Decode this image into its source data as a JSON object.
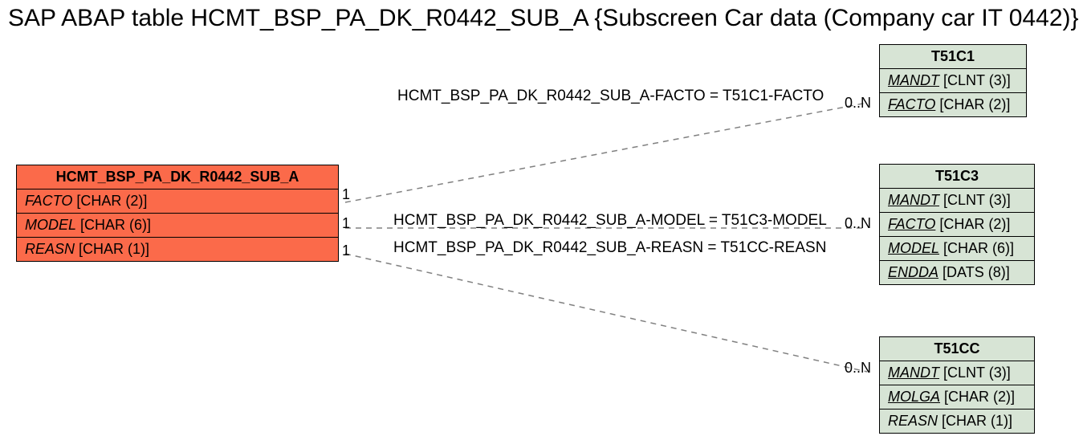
{
  "title": "SAP ABAP table HCMT_BSP_PA_DK_R0442_SUB_A {Subscreen Car data (Company car IT 0442)}",
  "main": {
    "name": "HCMT_BSP_PA_DK_R0442_SUB_A",
    "fields": [
      {
        "name": "FACTO",
        "type": "[CHAR (2)]"
      },
      {
        "name": "MODEL",
        "type": "[CHAR (6)]"
      },
      {
        "name": "REASN",
        "type": "[CHAR (1)]"
      }
    ]
  },
  "t51c1": {
    "name": "T51C1",
    "fields": [
      {
        "name": "MANDT",
        "type": "[CLNT (3)]",
        "pk": true
      },
      {
        "name": "FACTO",
        "type": "[CHAR (2)]",
        "pk": true
      }
    ]
  },
  "t51c3": {
    "name": "T51C3",
    "fields": [
      {
        "name": "MANDT",
        "type": "[CLNT (3)]",
        "pk": true
      },
      {
        "name": "FACTO",
        "type": "[CHAR (2)]",
        "pk": true
      },
      {
        "name": "MODEL",
        "type": "[CHAR (6)]",
        "pk": true
      },
      {
        "name": "ENDDA",
        "type": "[DATS (8)]",
        "pk": true
      }
    ]
  },
  "t51cc": {
    "name": "T51CC",
    "fields": [
      {
        "name": "MANDT",
        "type": "[CLNT (3)]",
        "pk": true
      },
      {
        "name": "MOLGA",
        "type": "[CHAR (2)]",
        "pk": true
      },
      {
        "name": "REASN",
        "type": "[CHAR (1)]",
        "pk": false
      }
    ]
  },
  "rels": {
    "r1": "HCMT_BSP_PA_DK_R0442_SUB_A-FACTO = T51C1-FACTO",
    "r2": "HCMT_BSP_PA_DK_R0442_SUB_A-MODEL = T51C3-MODEL",
    "r3": "HCMT_BSP_PA_DK_R0442_SUB_A-REASN = T51CC-REASN"
  },
  "card": {
    "one": "1",
    "many": "0..N"
  }
}
